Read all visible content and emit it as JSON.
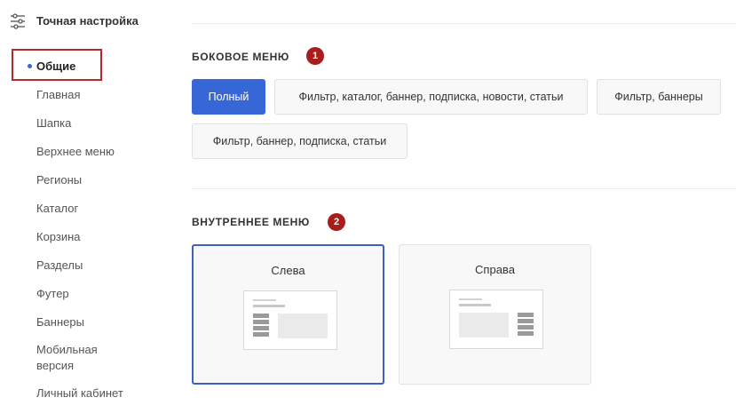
{
  "sidebar": {
    "title": "Точная настройка",
    "active_item": "Общие",
    "items": [
      "Главная",
      "Шапка",
      "Верхнее меню",
      "Регионы",
      "Каталог",
      "Корзина",
      "Разделы",
      "Футер",
      "Баннеры",
      "Мобильная версия",
      "Личный кабинет"
    ]
  },
  "side_menu": {
    "title": "БОКОВОЕ МЕНЮ",
    "badge": "1",
    "options": [
      "Полный",
      "Фильтр, каталог, баннер, подписка, новости, статьи",
      "Фильтр, баннеры",
      "Фильтр, баннер, подписка, статьи"
    ],
    "selected": "Полный"
  },
  "inner_menu": {
    "title": "ВНУТРЕННЕЕ МЕНЮ",
    "badge": "2",
    "options": [
      "Слева",
      "Справа"
    ],
    "selected": "Слева"
  },
  "colors": {
    "accent": "#3767d6",
    "badge": "#a91d1d",
    "highlight_border": "#b22a2a"
  }
}
